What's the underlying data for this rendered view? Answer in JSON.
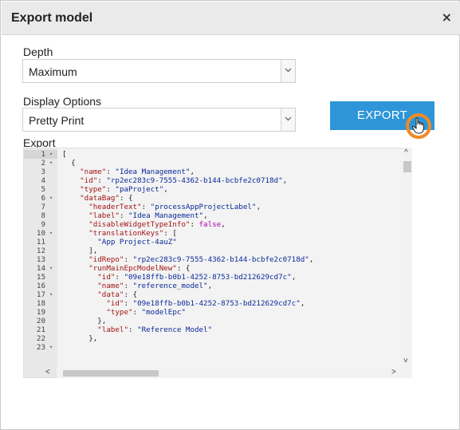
{
  "dialog": {
    "title": "Export model",
    "close_glyph": "×"
  },
  "depth": {
    "label": "Depth",
    "value": "Maximum"
  },
  "display_options": {
    "label": "Display Options",
    "value": "Pretty Print"
  },
  "export_button": {
    "label": "EXPORT"
  },
  "export_area": {
    "label": "Export",
    "lines": [
      {
        "n": "1",
        "fold": true,
        "code": "["
      },
      {
        "n": "2",
        "fold": true,
        "code": "  {"
      },
      {
        "n": "3",
        "fold": false,
        "code": "    \"name\": \"Idea Management\","
      },
      {
        "n": "4",
        "fold": false,
        "code": "    \"id\": \"rp2ec283c9-7555-4362-b144-bcbfe2c0718d\","
      },
      {
        "n": "5",
        "fold": false,
        "code": "    \"type\": \"paProject\","
      },
      {
        "n": "6",
        "fold": true,
        "code": "    \"dataBag\": {"
      },
      {
        "n": "7",
        "fold": false,
        "code": "      \"headerText\": \"processAppProjectLabel\","
      },
      {
        "n": "8",
        "fold": false,
        "code": "      \"label\": \"Idea Management\","
      },
      {
        "n": "9",
        "fold": false,
        "code": "      \"disableWidgetTypeInfo\": false,"
      },
      {
        "n": "10",
        "fold": true,
        "code": "      \"translationKeys\": ["
      },
      {
        "n": "11",
        "fold": false,
        "code": "        \"App Project-4auZ\""
      },
      {
        "n": "12",
        "fold": false,
        "code": "      ],"
      },
      {
        "n": "13",
        "fold": false,
        "code": "      \"idRepo\": \"rp2ec283c9-7555-4362-b144-bcbfe2c0718d\","
      },
      {
        "n": "14",
        "fold": true,
        "code": "      \"runMainEpcModelNew\": {"
      },
      {
        "n": "15",
        "fold": false,
        "code": "        \"id\": \"09e18ffb-b0b1-4252-8753-bd212629cd7c\","
      },
      {
        "n": "16",
        "fold": false,
        "code": "        \"name\": \"reference_model\","
      },
      {
        "n": "17",
        "fold": true,
        "code": "        \"data\": {"
      },
      {
        "n": "18",
        "fold": false,
        "code": "          \"id\": \"09e18ffb-b0b1-4252-8753-bd212629cd7c\","
      },
      {
        "n": "19",
        "fold": false,
        "code": "          \"type\": \"modelEpc\""
      },
      {
        "n": "20",
        "fold": false,
        "code": "        },"
      },
      {
        "n": "21",
        "fold": false,
        "code": "        \"label\": \"Reference Model\""
      },
      {
        "n": "22",
        "fold": false,
        "code": "      },"
      },
      {
        "n": "23",
        "fold": true,
        "code": ""
      }
    ]
  },
  "colors": {
    "accent": "#2e96d8",
    "cursor_highlight": "#f08a24",
    "json_key": "#a31515",
    "json_string": "#0b2a99",
    "json_boolean": "#b000b0"
  },
  "icons": {
    "select_arrow": "chevron-down-icon",
    "close": "close-icon",
    "cursor": "hand-pointer-icon"
  }
}
